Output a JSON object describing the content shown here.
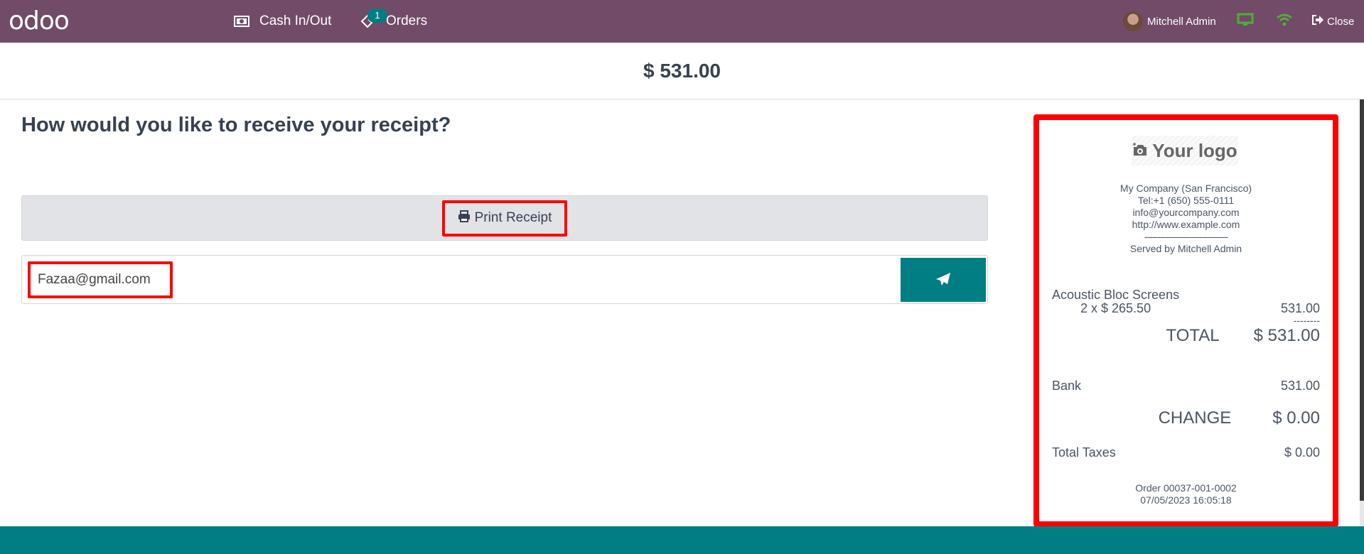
{
  "navbar": {
    "logo": "odoo",
    "cash_in_out": "Cash In/Out",
    "orders": "Orders",
    "orders_badge": "1",
    "user_name": "Mitchell Admin",
    "close": "Close",
    "icons": {
      "cash": "money-bill-icon",
      "orders": "ticket-icon",
      "avatar": "user-avatar",
      "monitor": "desktop-icon",
      "wifi": "wifi-icon",
      "close": "sign-out-icon"
    },
    "status_color": "#4fae3a"
  },
  "amount": "$ 531.00",
  "main": {
    "title": "How would you like to receive your receipt?",
    "print_label": "Print Receipt",
    "email_value": "Fazaa@gmail.com",
    "send_icon": "paper-plane-icon"
  },
  "receipt": {
    "logo_text": "Your logo",
    "company": {
      "name": "My Company (San Francisco)",
      "tel": "Tel:+1 (650) 555-0111",
      "email": "info@yourcompany.com",
      "website": "http://www.example.com",
      "separator": "--------------------------------",
      "served_by": "Served by Mitchell Admin"
    },
    "lines": [
      {
        "product": "Acoustic Bloc Screens",
        "qty_price": "2 x $ 265.50",
        "amount": "531.00"
      }
    ],
    "subtotal_separator": "--------",
    "total_label": "TOTAL",
    "total_value": "$ 531.00",
    "payment_label": "Bank",
    "payment_value": "531.00",
    "change_label": "CHANGE",
    "change_value": "$ 0.00",
    "taxes_label": "Total Taxes",
    "taxes_value": "$ 0.00",
    "order_ref": "Order 00037-001-0002",
    "order_date": "07/05/2023 16:05:18"
  },
  "colors": {
    "navbar": "#714B67",
    "accent": "#017E84",
    "highlight": "#ff0000"
  }
}
